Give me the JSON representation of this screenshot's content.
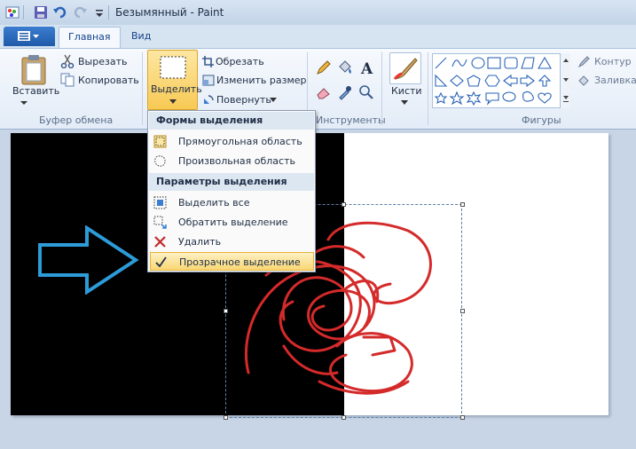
{
  "window": {
    "title": "Безымянный - Paint"
  },
  "tabs": [
    {
      "label": "Главная",
      "active": true
    },
    {
      "label": "Вид",
      "active": false
    }
  ],
  "ribbon": {
    "clipboard": {
      "paste": "Вставить",
      "cut": "Вырезать",
      "copy": "Копировать",
      "group": "Буфер обмена"
    },
    "image": {
      "select": "Выделить",
      "crop": "Обрезать",
      "resize": "Изменить размер",
      "rotate": "Повернуть"
    },
    "tools": {
      "group": "Инструменты"
    },
    "brushes": {
      "label": "Кисти"
    },
    "shapes": {
      "group": "Фигуры",
      "outline": "Контур",
      "fill": "Заливка"
    }
  },
  "menu": {
    "header1": "Формы выделения",
    "rect": "Прямоугольная область",
    "free": "Произвольная область",
    "header2": "Параметры выделения",
    "select_all": "Выделить все",
    "invert": "Обратить выделение",
    "delete": "Удалить",
    "transparent": "Прозрачное выделение"
  },
  "colors": {
    "accent": "#f8c954",
    "arrow": "#2d9bd8",
    "scribble": "#d42a2a"
  }
}
